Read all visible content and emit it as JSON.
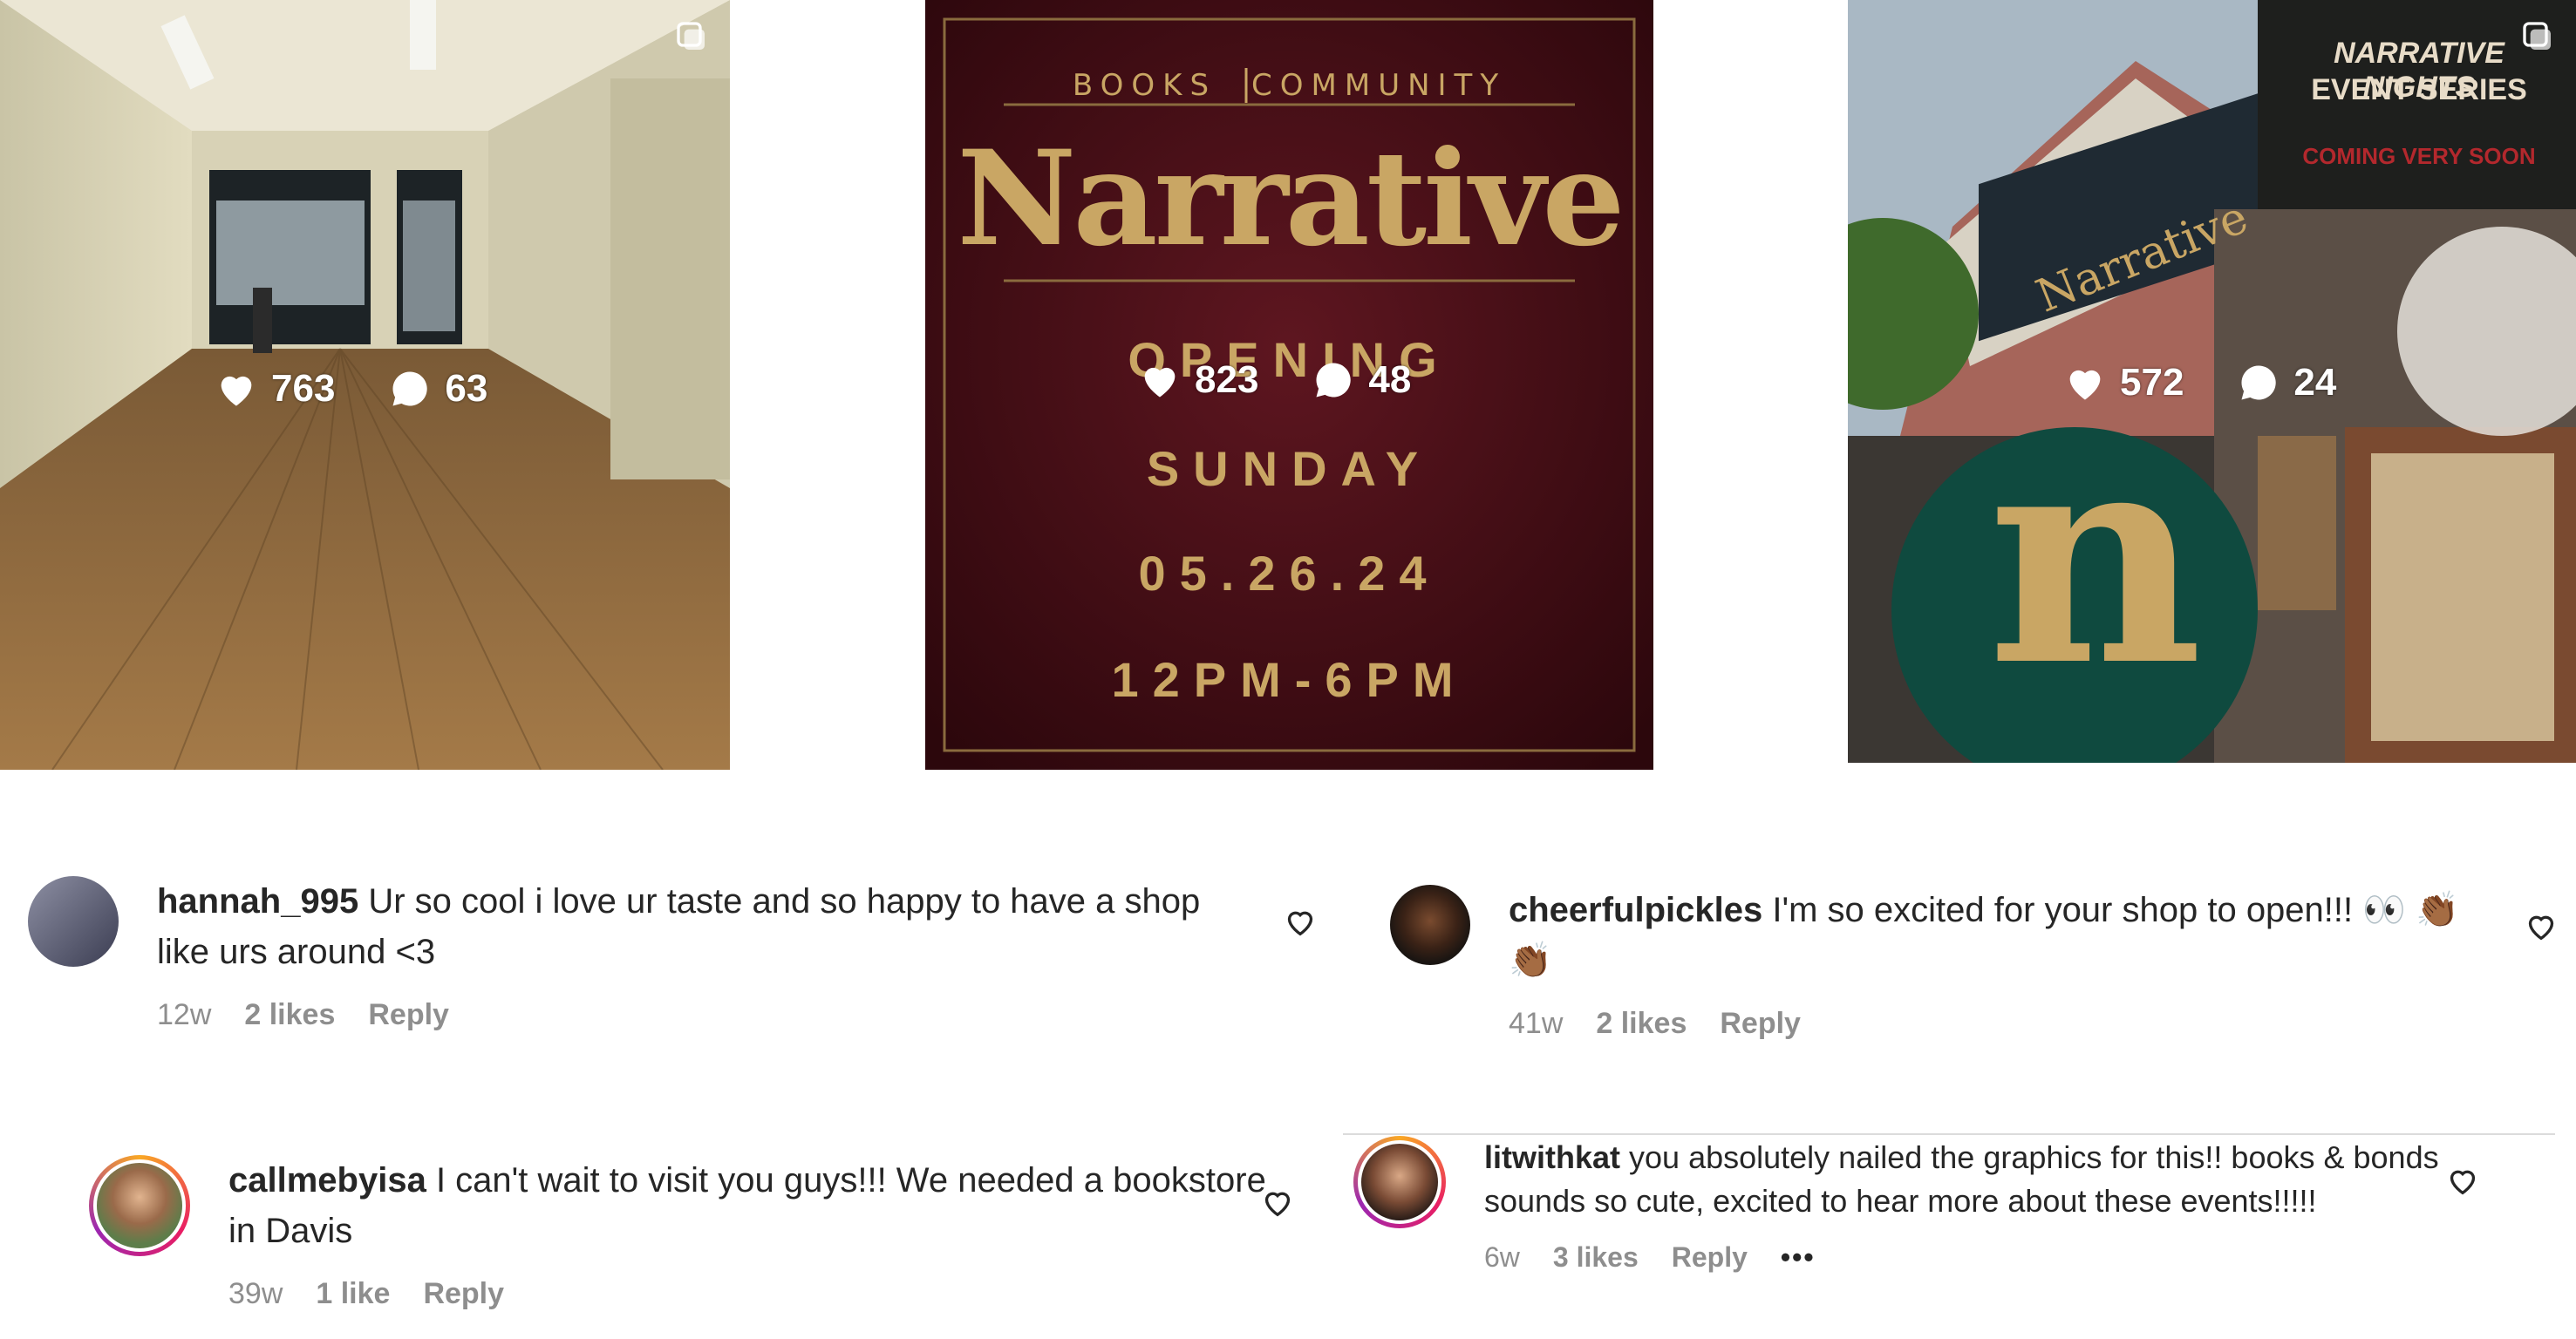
{
  "posts": [
    {
      "likes": "763",
      "comments": "63"
    },
    {
      "likes": "823",
      "comments": "48",
      "poster": {
        "header_left": "BOOKS",
        "header_right": "COMMUNITY",
        "brand": "Narrative",
        "line1": "OPENING",
        "line2": "SUNDAY",
        "line3": "05.26.24",
        "line4": "12PM-6PM"
      }
    },
    {
      "likes": "572",
      "comments": "24",
      "poster": {
        "title1": "NARRATIVE NIGHTS",
        "title2": "EVENT SERIES",
        "subtitle": "COMING VERY SOON",
        "sign": "Narrative",
        "monogram": "n"
      }
    }
  ],
  "comments": [
    {
      "username": "hannah_995",
      "text": "Ur so cool i love ur taste and so happy to have a shop like urs around <3",
      "age": "12w",
      "likes": "2 likes",
      "reply": "Reply"
    },
    {
      "username": "cheerfulpickles",
      "text": "I'm so excited for your shop to open!!! 👀 👏🏾 👏🏾",
      "age": "41w",
      "likes": "2 likes",
      "reply": "Reply"
    },
    {
      "username": "callmebyisa",
      "text": "I can't wait to visit you guys!!! We needed a bookstore in Davis",
      "age": "39w",
      "likes": "1 like",
      "reply": "Reply"
    },
    {
      "username": "litwithkat",
      "text": "you absolutely nailed the graphics for this!! books & bonds sounds so cute, excited to hear more about these events!!!!!",
      "age": "6w",
      "likes": "3 likes",
      "reply": "Reply",
      "more": "•••"
    }
  ],
  "colors": {
    "poster_bg": "#4a0f18",
    "poster_gold": "#c9a664",
    "event_green": "#0f4a3f"
  }
}
